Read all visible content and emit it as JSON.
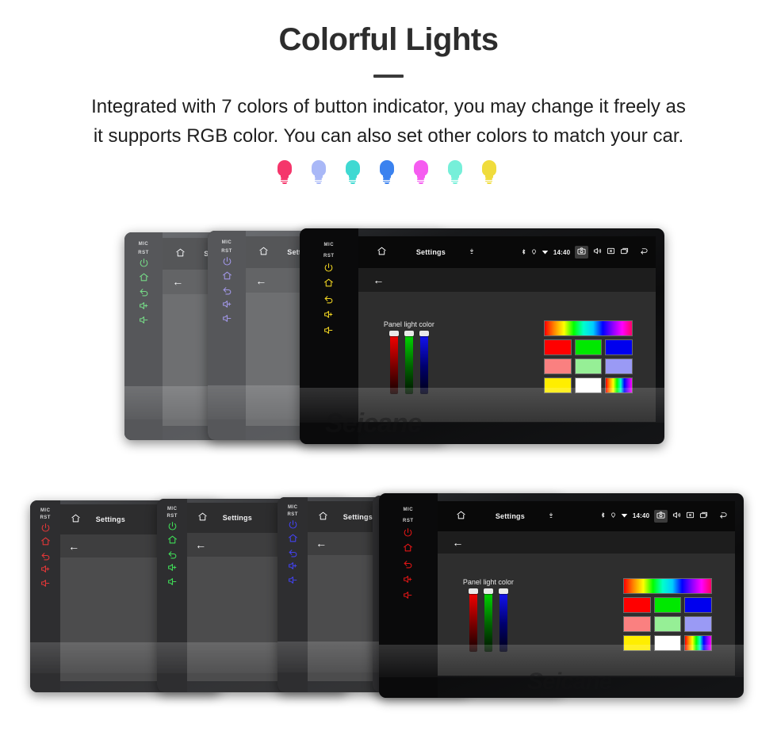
{
  "hero": {
    "title": "Colorful Lights",
    "subtitle_line1": "Integrated with 7 colors of button indicator, you may change it freely as",
    "subtitle_line2": "it supports RGB color. You can also set other colors to match your car."
  },
  "legend": {
    "items": [
      {
        "label": "red",
        "color": "#f5366b",
        "icon": "bulb-icon"
      },
      {
        "label": "Light blue",
        "color": "#a9b8f7",
        "icon": "bulb-icon"
      },
      {
        "label": "cyan",
        "color": "#3fd9d2",
        "icon": "bulb-icon"
      },
      {
        "label": "blue",
        "color": "#3b82ef",
        "icon": "bulb-icon"
      },
      {
        "label": "pink",
        "color": "#f55cf0",
        "icon": "bulb-icon"
      },
      {
        "label": "light cyan",
        "color": "#76efd9",
        "icon": "bulb-icon"
      },
      {
        "label": "yellow",
        "color": "#f0dc3c",
        "icon": "bulb-icon"
      }
    ]
  },
  "device_ui": {
    "status_home_icon": "home-icon",
    "status_title": "Settings",
    "status_mic_icon": "microphone-icon",
    "bluetooth_icon": "bluetooth-icon",
    "location_icon": "location-icon",
    "wifi_icon": "wifi-icon",
    "time": "14:40",
    "camera_icon": "camera-icon",
    "volume_icon": "volume-icon",
    "close_box_icon": "close-box-icon",
    "recents_icon": "recents-icon",
    "back_nav_icon": "back-arrow-icon",
    "back_arrow": "←",
    "bezel_mic_label": "MIC",
    "bezel_rst_label": "RST",
    "bezel_power_icon": "power-icon",
    "bezel_home_icon": "home-icon",
    "bezel_back_icon": "back-icon",
    "bezel_volup_icon": "volume-up-icon",
    "bezel_voldown_icon": "volume-down-icon",
    "panel_label": "Panel light color",
    "panel_label_clipped": "Pan",
    "swatch_rows": [
      [
        "#ff0000",
        "#00e800",
        "#0000ee"
      ],
      [
        "#fa8080",
        "#96ef96",
        "#9a9af5"
      ],
      [
        "#ffee00",
        "#ffffff",
        "rainbow"
      ]
    ]
  },
  "watermark": {
    "text": "Seicane"
  },
  "top_row_devices": [
    {
      "bezel_color": "#3ad14f",
      "variant": "compact"
    },
    {
      "bezel_color": "#7a6ae0",
      "variant": "compact"
    },
    {
      "bezel_color": "#f0d422",
      "variant": "full"
    }
  ],
  "bottom_row_devices": [
    {
      "bezel_color": "#e01515",
      "variant": "partial"
    },
    {
      "bezel_color": "#1ed93a",
      "variant": "partial"
    },
    {
      "bezel_color": "#2222ee",
      "variant": "partial"
    },
    {
      "bezel_color": "#e85a5a",
      "variant": "partial"
    },
    {
      "bezel_color": "#e01515",
      "variant": "full"
    }
  ]
}
